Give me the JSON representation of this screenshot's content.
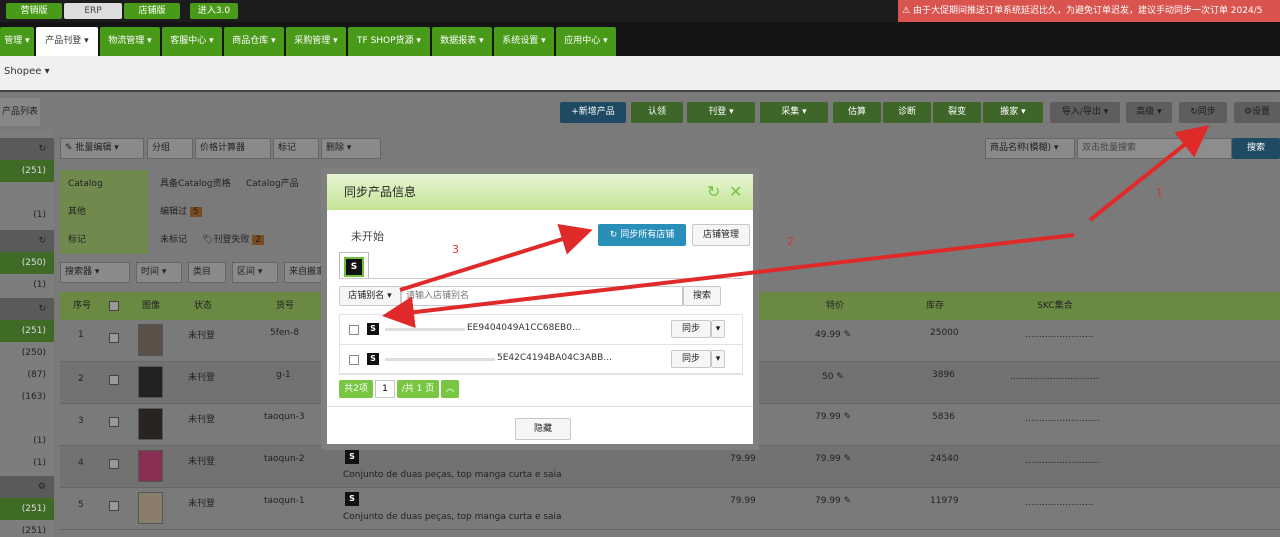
{
  "top": {
    "versions": [
      "营销版",
      "ERP",
      "店铺版"
    ],
    "enter": "进入3.0",
    "alert": "由于大促期间推送订单系统延迟比久，为避免订单迟发，建议手动同步一次订单 2024/5"
  },
  "nav": {
    "items": [
      "管理",
      "产品刊登",
      "物流管理",
      "客服中心",
      "商品仓库",
      "采购管理",
      "TF SHOP货源",
      "数据报表",
      "系统设置",
      "应用中心"
    ],
    "active_index": 1
  },
  "sub": {
    "platform": "Shopee"
  },
  "tab": "产品列表",
  "toolbar": [
    "新增产品",
    "认领",
    "刊登",
    "采集",
    "估算",
    "诊断",
    "裂变",
    "搬家",
    "导入/导出",
    "高级",
    "同步",
    "设置"
  ],
  "search": {
    "field": "商品名称(模糊)",
    "placeholder": "双击批量搜索",
    "button": "搜索"
  },
  "bulk": [
    "批量编辑",
    "分组",
    "价格计算器",
    "标记",
    "删除"
  ],
  "filters": [
    {
      "label": "Catalog",
      "values": [
        "具备Catalog资格",
        "Catalog产品"
      ]
    },
    {
      "label": "其他",
      "values": [
        "编辑过"
      ],
      "badge": "5"
    },
    {
      "label": "标记",
      "values": [
        "未标记",
        "刊登失败"
      ],
      "badge": "2"
    }
  ],
  "filter_dropdowns": [
    "搜索器",
    "时间",
    "类目",
    "区间",
    "来自搬家"
  ],
  "left_counts": [
    "(251)",
    "(1)",
    "(250)",
    "(1)",
    "(251)",
    "(250)",
    "(87)",
    "(163)",
    "(1)",
    "(1)",
    "(251)",
    "(251)"
  ],
  "table": {
    "headers": [
      "序号",
      "图像",
      "状态",
      "货号",
      "特价",
      "库存",
      "SKC集合"
    ],
    "rows": [
      {
        "no": "1",
        "status": "未刊登",
        "sku": "5fen-8",
        "title": "",
        "price": "",
        "special": "49.99",
        "stock": "25000",
        "skc": "........................"
      },
      {
        "no": "2",
        "status": "未刊登",
        "sku": "g-1",
        "title": "",
        "price": "",
        "special": "50",
        "stock": "3896",
        "skc": "..............................."
      },
      {
        "no": "3",
        "status": "未刊登",
        "sku": "taoqun-3",
        "title": "",
        "price": "",
        "special": "79.99",
        "stock": "5836",
        "skc": ".........................."
      },
      {
        "no": "4",
        "status": "未刊登",
        "sku": "taoqun-2",
        "title": "Conjunto de duas peças, top manga curta e saia",
        "price": "79.99",
        "special": "79.99",
        "stock": "24540",
        "skc": ".........................."
      },
      {
        "no": "5",
        "status": "未刊登",
        "sku": "taoqun-1",
        "title": "Conjunto de duas peças, top manga curta e saia",
        "price": "79.99",
        "special": "79.99",
        "stock": "11979",
        "skc": "........................"
      }
    ]
  },
  "modal": {
    "title": "同步产品信息",
    "status": "未开始",
    "sync_all": "同步所有店铺",
    "store_mgmt": "店铺管理",
    "store_letter": "S",
    "alias_label": "店铺别名",
    "alias_placeholder": "请输入店铺别名",
    "search": "搜索",
    "stores": [
      {
        "id": "EE9404049A1CC68EB0...",
        "action": "同步"
      },
      {
        "id": "5E42C4194BA04C3ABB...",
        "action": "同步"
      }
    ],
    "pager": {
      "total": "共2项",
      "page": "1",
      "pages": "/共 1 页"
    },
    "hide": "隐藏"
  },
  "annotations": [
    "1",
    "2",
    "3"
  ],
  "colors": {
    "green": "#5cb82a",
    "red": "#d9534f",
    "blue": "#2a8fb8"
  }
}
